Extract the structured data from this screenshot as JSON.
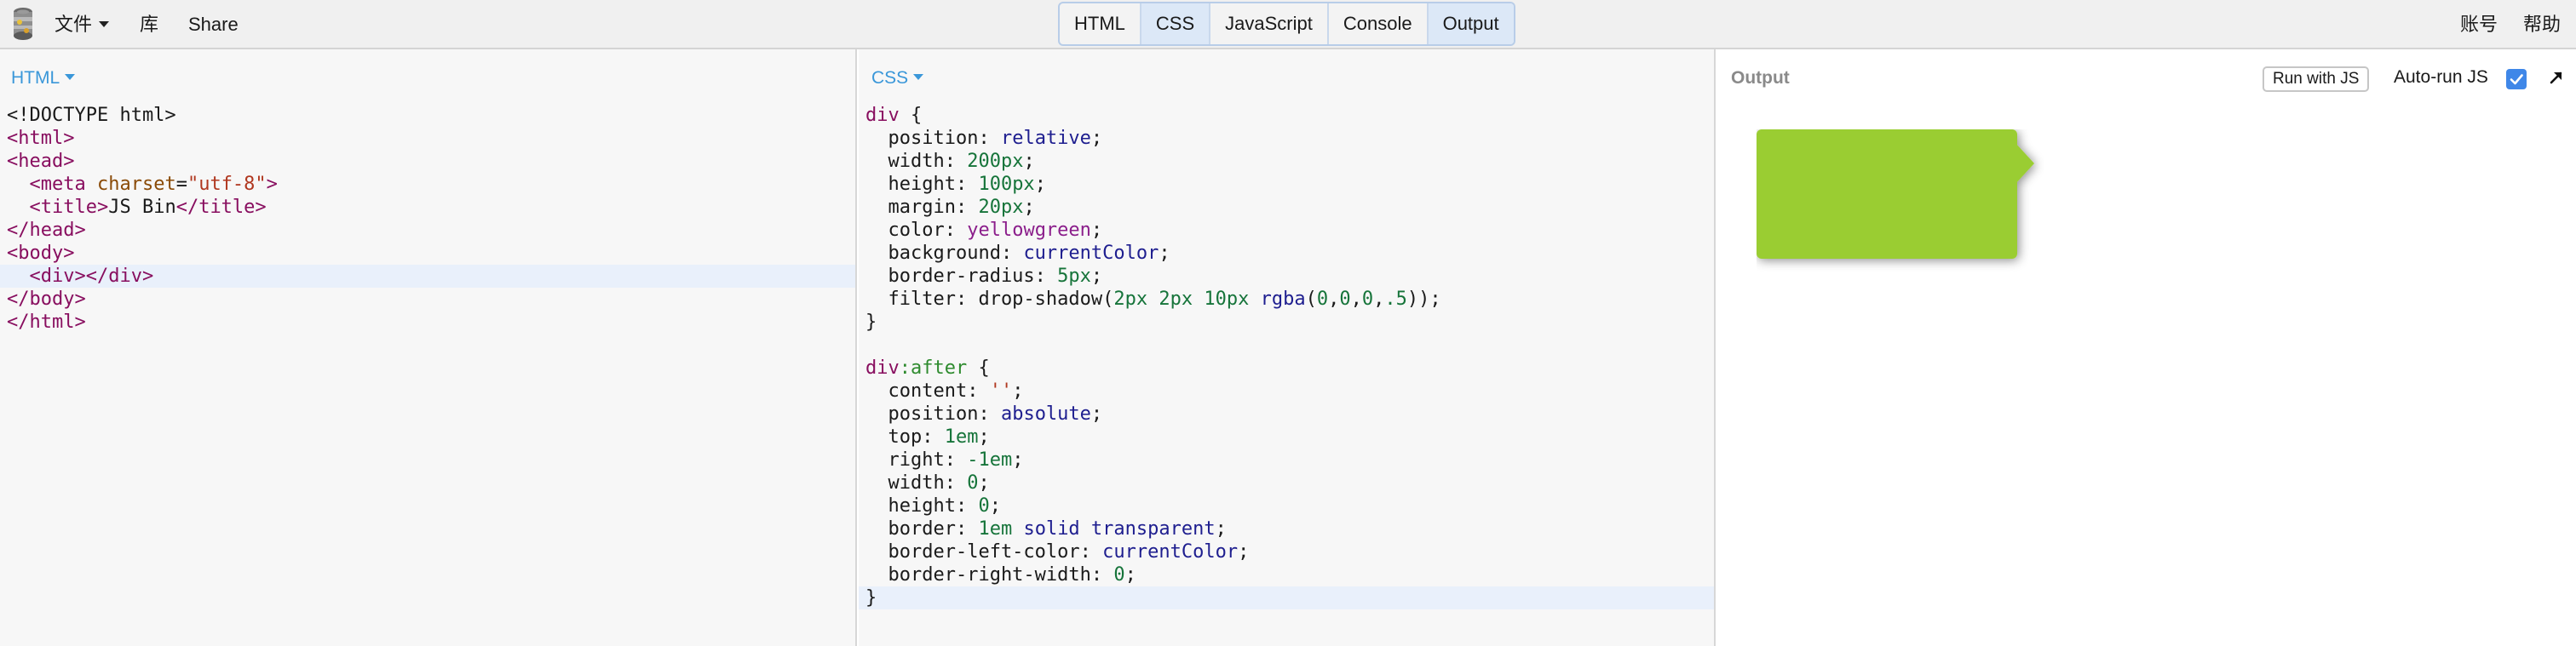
{
  "toolbar": {
    "menu": [
      {
        "label": "文件",
        "has_caret": true
      },
      {
        "label": "库"
      },
      {
        "label": "Share"
      }
    ],
    "panel_tabs": [
      {
        "label": "HTML",
        "active": false
      },
      {
        "label": "CSS",
        "active": true
      },
      {
        "label": "JavaScript",
        "active": false
      },
      {
        "label": "Console",
        "active": false
      },
      {
        "label": "Output",
        "active": true
      }
    ],
    "account_label": "账号",
    "help_label": "帮助"
  },
  "html_pane": {
    "label": "HTML",
    "lines": [
      [
        {
          "t": "<!DOCTYPE html>",
          "c": "txt"
        }
      ],
      [
        {
          "t": "<html>",
          "c": "tag"
        }
      ],
      [
        {
          "t": "<head>",
          "c": "tag"
        }
      ],
      [
        {
          "t": "  "
        },
        {
          "t": "<meta ",
          "c": "tag"
        },
        {
          "t": "charset",
          "c": "attr"
        },
        {
          "t": "=",
          "c": "txt"
        },
        {
          "t": "\"utf-8\"",
          "c": "str"
        },
        {
          "t": ">",
          "c": "tag"
        }
      ],
      [
        {
          "t": "  "
        },
        {
          "t": "<title>",
          "c": "tag"
        },
        {
          "t": "JS Bin",
          "c": "txt"
        },
        {
          "t": "</title>",
          "c": "tag"
        }
      ],
      [
        {
          "t": "</head>",
          "c": "tag"
        }
      ],
      [
        {
          "t": "<body>",
          "c": "tag"
        }
      ],
      [
        {
          "t": "  "
        },
        {
          "t": "<div></div>",
          "c": "tag"
        }
      ],
      [
        {
          "t": "</body>",
          "c": "tag"
        }
      ],
      [
        {
          "t": "</html>",
          "c": "tag"
        }
      ]
    ],
    "highlight_line": 7
  },
  "css_pane": {
    "label": "CSS",
    "lines": [
      [
        {
          "t": "div",
          "c": "sel"
        },
        {
          "t": " {",
          "c": "punc"
        }
      ],
      [
        {
          "t": "  position: ",
          "c": "prop"
        },
        {
          "t": "relative",
          "c": "kw"
        },
        {
          "t": ";",
          "c": "punc"
        }
      ],
      [
        {
          "t": "  width: ",
          "c": "prop"
        },
        {
          "t": "200px",
          "c": "num"
        },
        {
          "t": ";",
          "c": "punc"
        }
      ],
      [
        {
          "t": "  height: ",
          "c": "prop"
        },
        {
          "t": "100px",
          "c": "num"
        },
        {
          "t": ";",
          "c": "punc"
        }
      ],
      [
        {
          "t": "  margin: ",
          "c": "prop"
        },
        {
          "t": "20px",
          "c": "num"
        },
        {
          "t": ";",
          "c": "punc"
        }
      ],
      [
        {
          "t": "  color: ",
          "c": "prop"
        },
        {
          "t": "yellowgreen",
          "c": "col"
        },
        {
          "t": ";",
          "c": "punc"
        }
      ],
      [
        {
          "t": "  background: ",
          "c": "prop"
        },
        {
          "t": "currentColor",
          "c": "kw"
        },
        {
          "t": ";",
          "c": "punc"
        }
      ],
      [
        {
          "t": "  border-radius: ",
          "c": "prop"
        },
        {
          "t": "5px",
          "c": "num"
        },
        {
          "t": ";",
          "c": "punc"
        }
      ],
      [
        {
          "t": "  filter: drop-shadow(",
          "c": "prop"
        },
        {
          "t": "2px 2px 10px ",
          "c": "num"
        },
        {
          "t": "rgba",
          "c": "kw"
        },
        {
          "t": "(",
          "c": "punc"
        },
        {
          "t": "0",
          "c": "num"
        },
        {
          "t": ",",
          "c": "punc"
        },
        {
          "t": "0",
          "c": "num"
        },
        {
          "t": ",",
          "c": "punc"
        },
        {
          "t": "0",
          "c": "num"
        },
        {
          "t": ",",
          "c": "punc"
        },
        {
          "t": ".5",
          "c": "num"
        },
        {
          "t": "));",
          "c": "punc"
        }
      ],
      [
        {
          "t": "}",
          "c": "punc"
        }
      ],
      [
        {
          "t": ""
        }
      ],
      [
        {
          "t": "div",
          "c": "sel"
        },
        {
          "t": ":after",
          "c": "pseudo"
        },
        {
          "t": " {",
          "c": "punc"
        }
      ],
      [
        {
          "t": "  content: ",
          "c": "prop"
        },
        {
          "t": "''",
          "c": "str"
        },
        {
          "t": ";",
          "c": "punc"
        }
      ],
      [
        {
          "t": "  position: ",
          "c": "prop"
        },
        {
          "t": "absolute",
          "c": "kw"
        },
        {
          "t": ";",
          "c": "punc"
        }
      ],
      [
        {
          "t": "  top: ",
          "c": "prop"
        },
        {
          "t": "1em",
          "c": "num"
        },
        {
          "t": ";",
          "c": "punc"
        }
      ],
      [
        {
          "t": "  right: ",
          "c": "prop"
        },
        {
          "t": "-1em",
          "c": "num"
        },
        {
          "t": ";",
          "c": "punc"
        }
      ],
      [
        {
          "t": "  width: ",
          "c": "prop"
        },
        {
          "t": "0",
          "c": "num"
        },
        {
          "t": ";",
          "c": "punc"
        }
      ],
      [
        {
          "t": "  height: ",
          "c": "prop"
        },
        {
          "t": "0",
          "c": "num"
        },
        {
          "t": ";",
          "c": "punc"
        }
      ],
      [
        {
          "t": "  border: ",
          "c": "prop"
        },
        {
          "t": "1em",
          "c": "num"
        },
        {
          "t": " ",
          "c": "punc"
        },
        {
          "t": "solid transparent",
          "c": "kw"
        },
        {
          "t": ";",
          "c": "punc"
        }
      ],
      [
        {
          "t": "  border-left-color: ",
          "c": "prop"
        },
        {
          "t": "currentColor",
          "c": "kw"
        },
        {
          "t": ";",
          "c": "punc"
        }
      ],
      [
        {
          "t": "  border-right-width: ",
          "c": "prop"
        },
        {
          "t": "0",
          "c": "num"
        },
        {
          "t": ";",
          "c": "punc"
        }
      ],
      [
        {
          "t": "}",
          "c": "punc"
        }
      ]
    ],
    "highlight_line": 21
  },
  "output_pane": {
    "title": "Output",
    "run_button_label": "Run with JS",
    "autorun_label": "Auto-run JS",
    "autorun_checked": true,
    "preview_color": "#9acd32"
  },
  "colors": {
    "accent": "#3a97d9",
    "checkbox": "#3f87e8",
    "toolbar_bg": "#f0f0f0"
  }
}
